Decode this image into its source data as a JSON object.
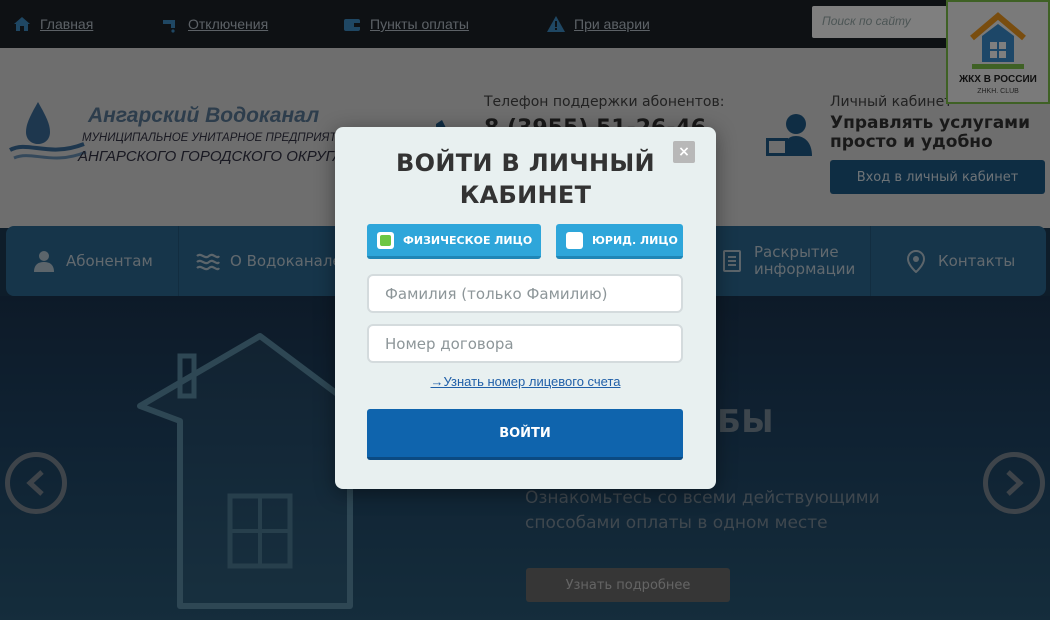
{
  "topbar": {
    "links": [
      "Главная",
      "Отключения",
      "Пункты оплаты",
      "При аварии"
    ],
    "search_placeholder": "Поиск по сайту"
  },
  "badge": {
    "title": "ЖКХ В РОССИИ",
    "sub": "ZHKH. CLUB"
  },
  "header": {
    "logo_title": "Ангарский Водоканал",
    "logo_sub1": "МУНИЦИПАЛЬНОЕ УНИТАРНОЕ ПРЕДПРИЯТИЕ",
    "logo_sub2": "АНГАРСКОГО ГОРОДСКОГО ОКРУГА",
    "phone_label": "Телефон поддержки абонентов:",
    "phone_number": "8 (3955) 51-26-46",
    "cabinet_label": "Личный кабинет",
    "cabinet_title": "Управлять услугами просто и удобно",
    "cabinet_button": "Вход в личный кабинет"
  },
  "nav": {
    "items": [
      "Абонентам",
      "О Водоканале",
      "Раскрытие информации",
      "Контакты"
    ]
  },
  "hero": {
    "title": "ЫЕ СПОСОБЫ",
    "text": "Ознакомьтесь со всеми действующими способами оплаты в одном месте",
    "button": "Узнать подробнее"
  },
  "modal": {
    "title": "ВОЙТИ В ЛИЧНЫЙ КАБИНЕТ",
    "close": "×",
    "option_individual": "ФИЗИЧЕСКОЕ ЛИЦО",
    "option_legal": "ЮРИД. ЛИЦО",
    "surname_placeholder": "Фамилия (только Фамилию)",
    "contract_placeholder": "Номер договора",
    "account_link": "→Узнать номер лицевого счета",
    "submit": "ВОЙТИ"
  },
  "colors": {
    "accent": "#0f64ad",
    "radio": "#2ea6da",
    "selected": "#6cc644"
  }
}
